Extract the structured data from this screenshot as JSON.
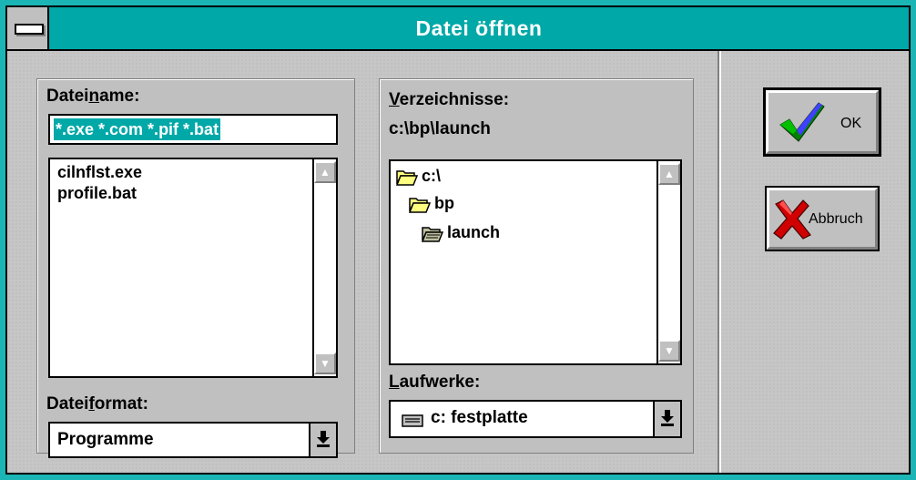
{
  "window": {
    "title": "Datei öffnen"
  },
  "filename": {
    "label_pre": "Datei",
    "label_ul": "n",
    "label_post": "ame:",
    "value": "*.exe *.com *.pif *.bat",
    "files": [
      "cilnflst.exe",
      "profile.bat"
    ]
  },
  "fileformat": {
    "label_pre": "Datei",
    "label_ul": "f",
    "label_post": "ormat:",
    "value": "Programme"
  },
  "directories": {
    "label_ul": "V",
    "label_post": "erzeichnisse:",
    "current_path": "c:\\bp\\launch",
    "tree": [
      "c:\\",
      "bp",
      "launch"
    ]
  },
  "drives": {
    "label_ul": "L",
    "label_post": "aufwerke:",
    "value": "c: festplatte"
  },
  "buttons": {
    "ok": "OK",
    "cancel": "Abbruch"
  },
  "colors": {
    "titlebar": "#00a8a8",
    "frame": "#1cb5b5",
    "face": "#c0c0c0"
  },
  "icons": {
    "ok": "checkmark-icon",
    "cancel": "x-icon",
    "folder": "folder-icon",
    "drive": "hard-drive-icon"
  }
}
